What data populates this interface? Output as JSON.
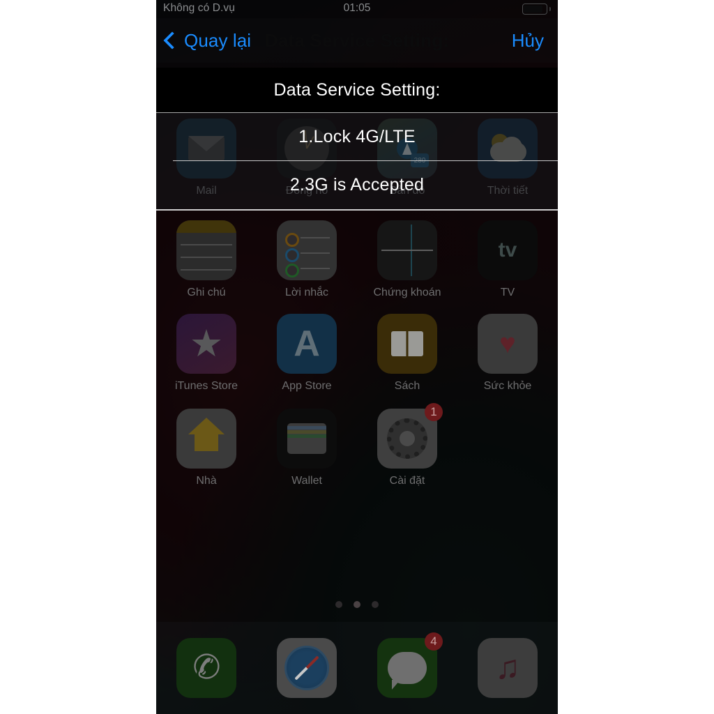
{
  "status_bar": {
    "carrier": "Không có D.vụ",
    "time": "01:05",
    "battery_icon": "battery-icon"
  },
  "nav_bar": {
    "back_label": "Quay lại",
    "title": "Data Service Setting:",
    "cancel_label": "Hủy"
  },
  "dialog": {
    "header": "Data Service Setting:",
    "options": [
      {
        "label": "1.Lock 4G/LTE"
      },
      {
        "label": "2.3G is Accepted"
      }
    ]
  },
  "home_screen": {
    "rows": [
      [
        {
          "label": "Mail",
          "icon": "mail-icon"
        },
        {
          "label": "Đồng hồ",
          "icon": "clock-icon"
        },
        {
          "label": "Bản đồ",
          "icon": "maps-icon"
        },
        {
          "label": "Thời tiết",
          "icon": "weather-icon"
        }
      ],
      [
        {
          "label": "Ghi chú",
          "icon": "notes-icon"
        },
        {
          "label": "Lời nhắc",
          "icon": "reminders-icon"
        },
        {
          "label": "Chứng khoán",
          "icon": "stocks-icon"
        },
        {
          "label": "TV",
          "icon": "tv-icon"
        }
      ],
      [
        {
          "label": "iTunes Store",
          "icon": "itunes-store-icon"
        },
        {
          "label": "App Store",
          "icon": "app-store-icon"
        },
        {
          "label": "Sách",
          "icon": "books-icon"
        },
        {
          "label": "Sức khỏe",
          "icon": "health-icon"
        }
      ],
      [
        {
          "label": "Nhà",
          "icon": "home-icon"
        },
        {
          "label": "Wallet",
          "icon": "wallet-icon"
        },
        {
          "label": "Cài đặt",
          "icon": "settings-icon",
          "badge": "1"
        }
      ]
    ],
    "page_dots": {
      "count": 3,
      "active_index": 1
    }
  },
  "dock": {
    "items": [
      {
        "label": "Phone",
        "icon": "phone-icon"
      },
      {
        "label": "Safari",
        "icon": "safari-icon"
      },
      {
        "label": "Messages",
        "icon": "messages-icon",
        "badge": "4"
      },
      {
        "label": "Music",
        "icon": "music-icon"
      }
    ]
  },
  "colors": {
    "accent_blue": "#1a8cff",
    "badge_red": "#6e1a1c",
    "dialog_header_bg": "#000000",
    "separator": "#c9c9c9"
  },
  "misc": {
    "maps_shield_number": "280",
    "tv_text": "tv",
    "star_glyph": "★",
    "heart_glyph": "♥",
    "phone_glyph": "✆",
    "note_glyph": "♫",
    "appstore_glyph": "A"
  }
}
